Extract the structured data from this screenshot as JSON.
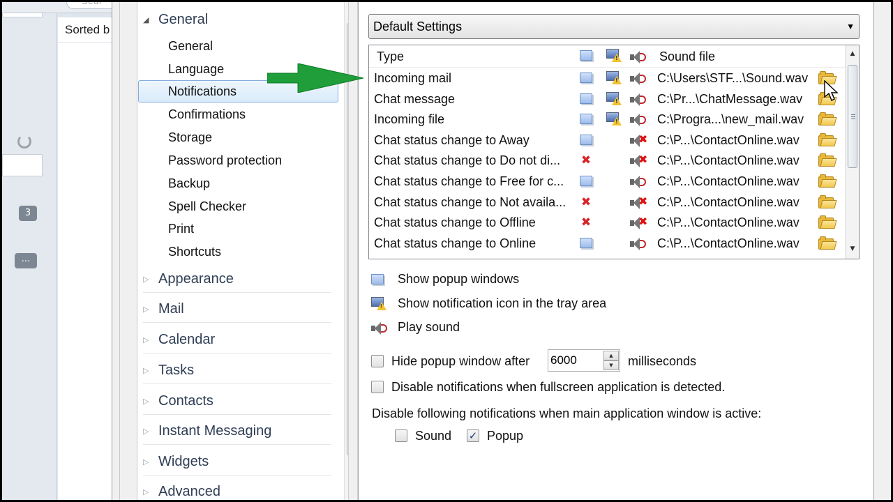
{
  "background_app": {
    "search_placeholder": "Sear",
    "sorted_label": "Sorted b",
    "badge_count": "3",
    "more_label": "..."
  },
  "nav": {
    "groups": [
      {
        "label": "General",
        "expanded": true
      },
      {
        "label": "Appearance",
        "expanded": false
      },
      {
        "label": "Mail",
        "expanded": false
      },
      {
        "label": "Calendar",
        "expanded": false
      },
      {
        "label": "Tasks",
        "expanded": false
      },
      {
        "label": "Contacts",
        "expanded": false
      },
      {
        "label": "Instant Messaging",
        "expanded": false
      },
      {
        "label": "Widgets",
        "expanded": false
      },
      {
        "label": "Advanced",
        "expanded": false
      }
    ],
    "items": [
      {
        "label": "General"
      },
      {
        "label": "Language"
      },
      {
        "label": "Notifications",
        "selected": true
      },
      {
        "label": "Confirmations"
      },
      {
        "label": "Storage"
      },
      {
        "label": "Password protection"
      },
      {
        "label": "Backup"
      },
      {
        "label": "Spell Checker"
      },
      {
        "label": "Print"
      },
      {
        "label": "Shortcuts"
      }
    ]
  },
  "profile_select": {
    "value": "Default Settings"
  },
  "grid": {
    "headers": {
      "type": "Type",
      "sound_file": "Sound file"
    },
    "header_icons": [
      "popup-icon",
      "tray-icon",
      "speaker-icon"
    ],
    "rows": [
      {
        "type": "Incoming mail",
        "popup": "on",
        "tray": "on",
        "sound": "on",
        "file": "C:\\Users\\STF...\\Sound.wav"
      },
      {
        "type": "Chat message",
        "popup": "on",
        "tray": "on",
        "sound": "on",
        "file": "C:\\Pr...\\ChatMessage.wav"
      },
      {
        "type": "Incoming file",
        "popup": "on",
        "tray": "on",
        "sound": "on",
        "file": "C:\\Progra...\\new_mail.wav"
      },
      {
        "type": "Chat status change to Away",
        "popup": "on",
        "tray": "none",
        "sound": "off",
        "file": "C:\\P...\\ContactOnline.wav"
      },
      {
        "type": "Chat status change to Do not di...",
        "popup": "off",
        "tray": "none",
        "sound": "off",
        "file": "C:\\P...\\ContactOnline.wav"
      },
      {
        "type": "Chat status change to Free for c...",
        "popup": "on",
        "tray": "none",
        "sound": "on",
        "file": "C:\\P...\\ContactOnline.wav"
      },
      {
        "type": "Chat status change to Not availa...",
        "popup": "off",
        "tray": "none",
        "sound": "off",
        "file": "C:\\P...\\ContactOnline.wav"
      },
      {
        "type": "Chat status change to Offline",
        "popup": "off",
        "tray": "none",
        "sound": "off",
        "file": "C:\\P...\\ContactOnline.wav"
      },
      {
        "type": "Chat status change to Online",
        "popup": "on",
        "tray": "none",
        "sound": "on",
        "file": "C:\\P...\\ContactOnline.wav"
      }
    ]
  },
  "legend": {
    "popup": "Show popup windows",
    "tray": "Show notification icon in the tray area",
    "sound": "Play sound"
  },
  "options": {
    "hide_popup_label": "Hide popup window after",
    "hide_popup_checked": false,
    "hide_popup_value": "6000",
    "milliseconds_label": "milliseconds",
    "disable_fullscreen_label": "Disable notifications when fullscreen application is detected.",
    "disable_fullscreen_checked": false,
    "disable_when_active_label": "Disable following notifications when main application window is active:",
    "sound_label": "Sound",
    "sound_checked": false,
    "popup_label": "Popup",
    "popup_checked": true
  },
  "colors": {
    "selection_border": "#84acdd",
    "annotation_arrow": "#1f9e3a",
    "error_red": "#d8262b",
    "folder_yellow": "#f2c94c"
  }
}
